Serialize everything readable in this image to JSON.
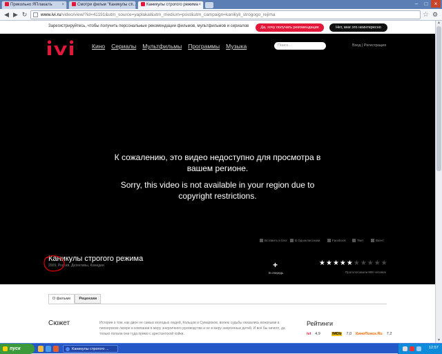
{
  "browser": {
    "tabs": [
      {
        "label": "Прикольно ЯПлакалъ"
      },
      {
        "label": "Смотри фильм \"Каникулы ст..."
      },
      {
        "label": "Каникулы строгого режима"
      }
    ],
    "url_host": "www.ivi.ru",
    "url_rest": "/video/view/?id=41191&utm_source=yaplakal&utm_medium=post&utm_campaign=kanikyli_strogogo_rejima",
    "icons": [
      "back-icon",
      "forward-icon",
      "reload-icon",
      "star-icon",
      "wrench-icon"
    ]
  },
  "promo": {
    "text": "Зарегистрируйтесь, чтобы получить персональные рекомендации фильмов, мультфильмов и сериалов",
    "yes_button": "Да, хочу получать рекомендации",
    "no_button": "Нет, мне это неинтересно"
  },
  "site": {
    "logo": "ivi",
    "nav": [
      "Кино",
      "Сериалы",
      "Мультфильмы",
      "Программы",
      "Музыка"
    ],
    "search_placeholder": "Поиск...",
    "login": "Вход | Регистрация",
    "message_ru": "К сожалению, это видео недоступно для просмотра в вашем регионе.",
    "message_en": "Sorry, this video is not available in your region due to copyright restrictions.",
    "movie_title": "Каникулы строгого режима",
    "movie_meta": "2009, Россия, Детективы, Комедии",
    "share": [
      "Вставить в блог",
      "В Одноклассники",
      "Facebook",
      "Твит",
      "Вконт"
    ],
    "queue_label": "В очередь",
    "rating_stars": 5,
    "rating_max": 10,
    "votes_text": "Проголосовали 998 человек"
  },
  "details": {
    "tabs": [
      "О фильме",
      "Рецензии"
    ],
    "plot_heading": "Сюжет",
    "plot_text": "История о том, как двое не самых молодых людей, Кольцов и Сумароков, волею судьбы оказались вожатыми в пионерском лагере в компании в меру энергичного руководства и не в меру энергичных детей. И всё бы ничего, да только попали они туда прямо с арестантской койки.",
    "ratings_heading": "Рейтинги",
    "ratings": [
      {
        "source": "ivi",
        "value": "4,9"
      },
      {
        "source": "IMDb",
        "value": "7,0"
      },
      {
        "source": "КиноПоиск.Ru",
        "value": "7,2"
      }
    ]
  },
  "taskbar": {
    "start": "пуск",
    "window": "Каникулы строгого ...",
    "clock": "12:57"
  },
  "colors": {
    "brand": "#e2173a",
    "site_bg": "#000000",
    "taskbar": "#2457c8"
  }
}
